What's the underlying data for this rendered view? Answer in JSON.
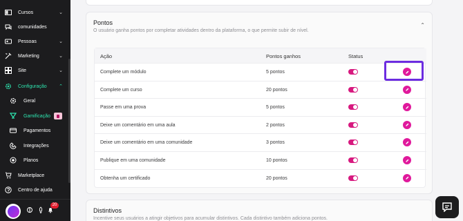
{
  "sidebar": {
    "items": [
      {
        "label": "Cursos",
        "icon": "courses-icon",
        "chevron": "⌄"
      },
      {
        "label": "comunidades",
        "icon": "community-icon",
        "chevron": ""
      },
      {
        "label": "Pessoas",
        "icon": "people-icon",
        "chevron": "⌄"
      },
      {
        "label": "Marketing",
        "icon": "marketing-icon",
        "chevron": "⌄"
      },
      {
        "label": "Site",
        "icon": "site-icon",
        "chevron": "⌄"
      },
      {
        "label": "Configuração",
        "icon": "settings-icon",
        "chevron": "⌃"
      }
    ],
    "sub_items": [
      {
        "label": "Geral",
        "icon": "gear-icon"
      },
      {
        "label": "Gamificação",
        "icon": "gamification-icon"
      },
      {
        "label": "Pagamentos",
        "icon": "card-icon"
      },
      {
        "label": "Integrações",
        "icon": "integrations-icon"
      },
      {
        "label": "Planos",
        "icon": "plans-icon"
      }
    ],
    "bottom_items": [
      {
        "label": "Marketplace",
        "icon": "marketplace-icon"
      },
      {
        "label": "Centro de ajuda",
        "icon": "help-icon"
      }
    ],
    "notifications_count": "20",
    "accent_color": "#2ee6b0"
  },
  "pontos": {
    "title": "Pontos",
    "subtitle": "O usuário ganha pontos por completar atividades dentro da plataforma, o que permite subir de nível.",
    "collapse_icon": "⌃",
    "columns": [
      "Ação",
      "Pontos ganhos",
      "Status"
    ],
    "rows": [
      {
        "action": "Complete um módulo",
        "points": "5 pontos"
      },
      {
        "action": "Complete um curso",
        "points": "20 pontos"
      },
      {
        "action": "Passe em uma prova",
        "points": "5 pontos"
      },
      {
        "action": "Deixe um comentário em uma aula",
        "points": "2 pontos"
      },
      {
        "action": "Deixe um comentário em uma comunidade",
        "points": "3 pontos"
      },
      {
        "action": "Publique em uma comunidade",
        "points": "10 pontos"
      },
      {
        "action": "Obtenha um certificado",
        "points": "20 pontos"
      }
    ],
    "toggle_color": "#d7197f",
    "edit_color": "#e0199c"
  },
  "distintivos": {
    "title": "Distintivos",
    "subtitle": "Incentive seus usuários a atingir objetivos para acumular distintivos. Cada distintivo também adiciona pontos."
  }
}
